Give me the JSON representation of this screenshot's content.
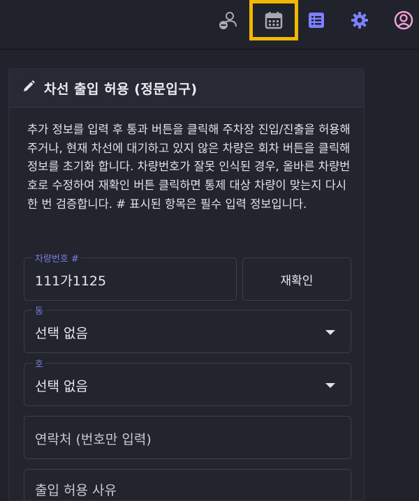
{
  "header": {
    "icons": [
      "user-minus-icon",
      "calendar-icon",
      "list-icon",
      "gear-icon",
      "account-circle-icon"
    ],
    "colors": {
      "icon_gray": "#a7a9b4",
      "icon_accent": "#7d80ff",
      "icon_pink": "#f29fd5",
      "highlight": "#f2b705"
    }
  },
  "card": {
    "title": "차선 출입 허용 (정문입구)",
    "description": "추가 정보를 입력 후 통과 버튼을 클릭해 주차장 진입/진출을 허용해주거나, 현재 차선에 대기하고 있지 않은 차량은 회차 버튼을 클릭해 정보를 초기화 합니다. 차량번호가 잘못 인식된 경우, 올바른 차량번호로 수정하여 재확인 버튼 클릭하면 통제 대상 차량이 맞는지 다시 한 번 검증합니다. # 표시된 항목은 필수 입력 정보입니다."
  },
  "form": {
    "plate": {
      "label": "차량번호 #",
      "value": "111가1125"
    },
    "recheck_button": "재확인",
    "dong": {
      "label": "동",
      "value": "선택 없음"
    },
    "ho": {
      "label": "호",
      "value": "선택 없음"
    },
    "contact": {
      "placeholder": "연락처 (번호만 입력)"
    },
    "reason": {
      "placeholder": "출입 허용 사유"
    }
  }
}
